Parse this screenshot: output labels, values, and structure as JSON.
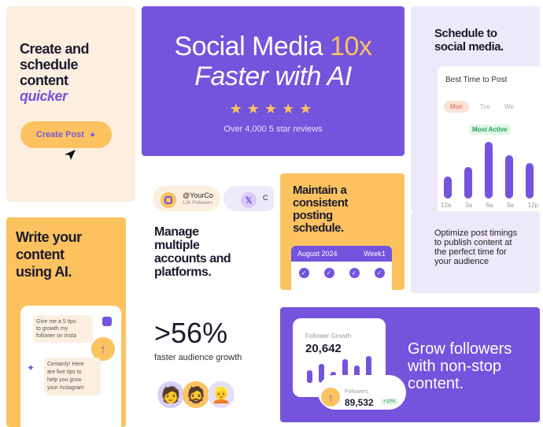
{
  "create_card": {
    "title_line1": "Create and",
    "title_line2": "schedule",
    "title_line3": "content",
    "title_accent": "quicker",
    "button_label": "Create Post"
  },
  "hero": {
    "title_line1_a": "Social Media ",
    "title_line1_b": "10x",
    "title_line2": "Faster with AI",
    "stars": [
      "★",
      "★",
      "★",
      "★",
      "★"
    ],
    "reviews": "Over 4,000 5 star reviews"
  },
  "accounts": {
    "handle": "@YourCo",
    "followers": "12K Followers",
    "x_handle": "C"
  },
  "schedule_card": {
    "title_line1": "Schedule to",
    "title_line2": "social media.",
    "best_time": "Best Time to Post",
    "days": [
      "Mon",
      "Tue",
      "We"
    ],
    "most_active": "Most Active",
    "hours": [
      "12a",
      "3a",
      "6a",
      "9a",
      "12p"
    ],
    "colors": {
      "bar": "#7453dd",
      "badge": "#23a25a"
    }
  },
  "chart_data": {
    "type": "bar",
    "categories": [
      "12a",
      "3a",
      "6a",
      "9a",
      "12p"
    ],
    "values": [
      28,
      40,
      72,
      55,
      45
    ],
    "title": "Best Time to Post",
    "xlabel": "",
    "ylabel": ""
  },
  "maintain_card": {
    "title_line1": "Maintain a",
    "title_line2": "consistent",
    "title_line3": "posting",
    "title_line4": "schedule.",
    "month": "August 2024",
    "week": "Week1"
  },
  "write_card": {
    "title_line1": "Write your",
    "title_line2": "content",
    "title_line3": "using AI.",
    "msg1_line1": "Give me a 5 tips",
    "msg1_line2": "to growth my",
    "msg1_line3": "follower on Insta",
    "msg2_line1": "Certainly! Here",
    "msg2_line2": "are five tips to",
    "msg2_line3": "help you grow",
    "msg2_line4": "your Instagram"
  },
  "manage_card": {
    "title_line1": "Manage",
    "title_line2": "multiple",
    "title_line3": "accounts and",
    "title_line4": "platforms."
  },
  "optimize_card": {
    "line1": "Optimize post timings",
    "line2": "to publish content at",
    "line3": "the perfect time for",
    "line4": "your audience"
  },
  "growth_card": {
    "stat": ">56%",
    "caption": "faster audience growth"
  },
  "follower_card": {
    "label": "Follower Growth",
    "value": "20,642",
    "followers_label": "Followers",
    "followers_value": "89,532",
    "badge": "+10%",
    "title_line1": "Grow followers",
    "title_line2": "with non-stop",
    "title_line3": "content."
  }
}
